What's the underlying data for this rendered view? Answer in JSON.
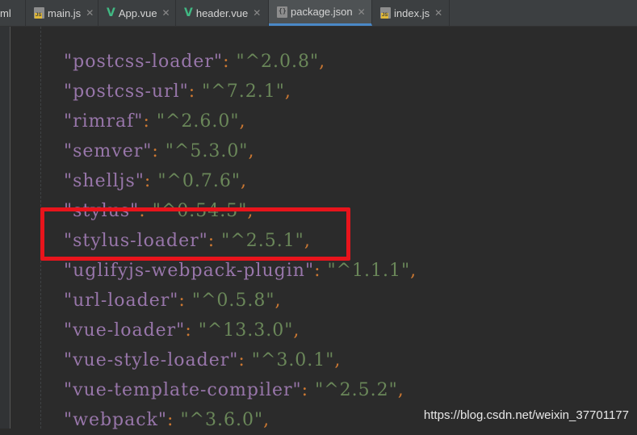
{
  "tabs": [
    {
      "label": "ml",
      "icon": "",
      "active": false,
      "closable": false
    },
    {
      "label": "main.js",
      "icon": "js-file-icon",
      "active": false,
      "closable": true
    },
    {
      "label": "App.vue",
      "icon": "vue-file-icon",
      "active": false,
      "closable": true
    },
    {
      "label": "header.vue",
      "icon": "vue-file-icon",
      "active": false,
      "closable": true
    },
    {
      "label": "package.json",
      "icon": "json-file-icon",
      "active": true,
      "closable": true
    },
    {
      "label": "index.js",
      "icon": "js-file-icon",
      "active": false,
      "closable": true
    }
  ],
  "close_glyph": "✕",
  "editor": {
    "lines": [
      {
        "key": "\"postcss-loader\"",
        "sep": ": ",
        "value": "\"^2.0.8\"",
        "end": ","
      },
      {
        "key": "\"postcss-url\"",
        "sep": ": ",
        "value": "\"^7.2.1\"",
        "end": ","
      },
      {
        "key": "\"rimraf\"",
        "sep": ": ",
        "value": "\"^2.6.0\"",
        "end": ","
      },
      {
        "key": "\"semver\"",
        "sep": ": ",
        "value": "\"^5.3.0\"",
        "end": ","
      },
      {
        "key": "\"shelljs\"",
        "sep": ": ",
        "value": "\"^0.7.6\"",
        "end": ","
      },
      {
        "key": "\"stylus\"",
        "sep": ": ",
        "value": "\"^0.54.5\"",
        "end": ","
      },
      {
        "key": "\"stylus-loader\"",
        "sep": ": ",
        "value": "\"^2.5.1\"",
        "end": ","
      },
      {
        "key": "\"uglifyjs-webpack-plugin\"",
        "sep": ": ",
        "value": "\"^1.1.1\"",
        "end": ","
      },
      {
        "key": "\"url-loader\"",
        "sep": ": ",
        "value": "\"^0.5.8\"",
        "end": ","
      },
      {
        "key": "\"vue-loader\"",
        "sep": ": ",
        "value": "\"^13.3.0\"",
        "end": ","
      },
      {
        "key": "\"vue-style-loader\"",
        "sep": ": ",
        "value": "\"^3.0.1\"",
        "end": ","
      },
      {
        "key": "\"vue-template-compiler\"",
        "sep": ": ",
        "value": "\"^2.5.2\"",
        "end": ","
      },
      {
        "key": "\"webpack\"",
        "sep": ": ",
        "value": "\"^3.6.0\"",
        "end": ","
      }
    ],
    "highlighted_line": "stylus-loader"
  },
  "colors": {
    "background": "#2b2b2b",
    "key": "#9876aa",
    "string": "#6a8759",
    "punctuation": "#cc7832",
    "highlight_box": "#e8141c"
  },
  "watermark": "https://blog.csdn.net/weixin_37701177"
}
